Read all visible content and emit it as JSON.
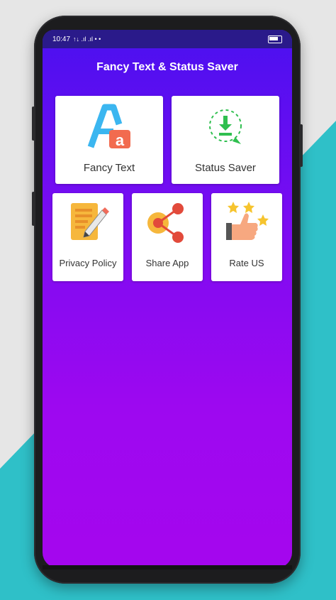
{
  "status_bar": {
    "time": "10:47",
    "signal_text": "↑↓ .ıl .ıl • •"
  },
  "app": {
    "title": "Fancy Text & Status Saver"
  },
  "cards": {
    "fancy_text": {
      "label": "Fancy Text",
      "icon": "fancy-text-icon"
    },
    "status_saver": {
      "label": "Status Saver",
      "icon": "download-icon"
    },
    "privacy_policy": {
      "label": "Privacy Policy",
      "icon": "document-pen-icon"
    },
    "share_app": {
      "label": "Share App",
      "icon": "share-icon"
    },
    "rate_us": {
      "label": "Rate US",
      "icon": "thumbs-up-stars-icon"
    }
  },
  "colors": {
    "gradient_top": "#4a10f0",
    "gradient_bottom": "#a506ee",
    "teal": "#2fc0c8",
    "card": "#ffffff"
  }
}
